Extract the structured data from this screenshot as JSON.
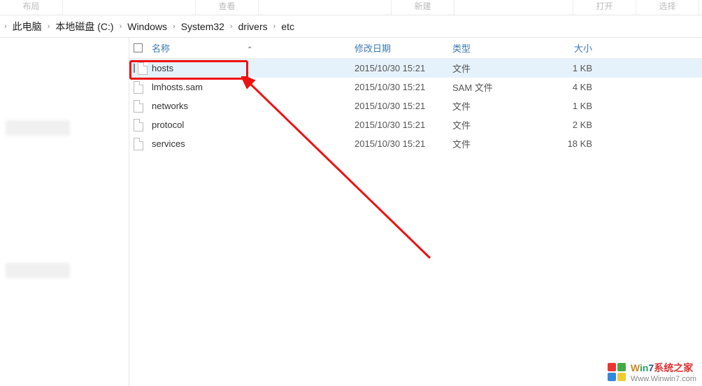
{
  "ribbon_tabs": [
    "布局",
    "查看",
    "新建",
    "打开",
    "选择"
  ],
  "breadcrumb": [
    "此电脑",
    "本地磁盘 (C:)",
    "Windows",
    "System32",
    "drivers",
    "etc"
  ],
  "columns": {
    "name": "名称",
    "date": "修改日期",
    "type": "类型",
    "size": "大小"
  },
  "files": [
    {
      "name": "hosts",
      "date": "2015/10/30 15:21",
      "type": "文件",
      "size": "1 KB",
      "selected": true
    },
    {
      "name": "lmhosts.sam",
      "date": "2015/10/30 15:21",
      "type": "SAM 文件",
      "size": "4 KB",
      "selected": false
    },
    {
      "name": "networks",
      "date": "2015/10/30 15:21",
      "type": "文件",
      "size": "1 KB",
      "selected": false
    },
    {
      "name": "protocol",
      "date": "2015/10/30 15:21",
      "type": "文件",
      "size": "2 KB",
      "selected": false
    },
    {
      "name": "services",
      "date": "2015/10/30 15:21",
      "type": "文件",
      "size": "18 KB",
      "selected": false
    }
  ],
  "watermark": {
    "title_parts": [
      "W",
      "in",
      "7",
      "系统之家"
    ],
    "url": "Www.Winwin7.com"
  }
}
